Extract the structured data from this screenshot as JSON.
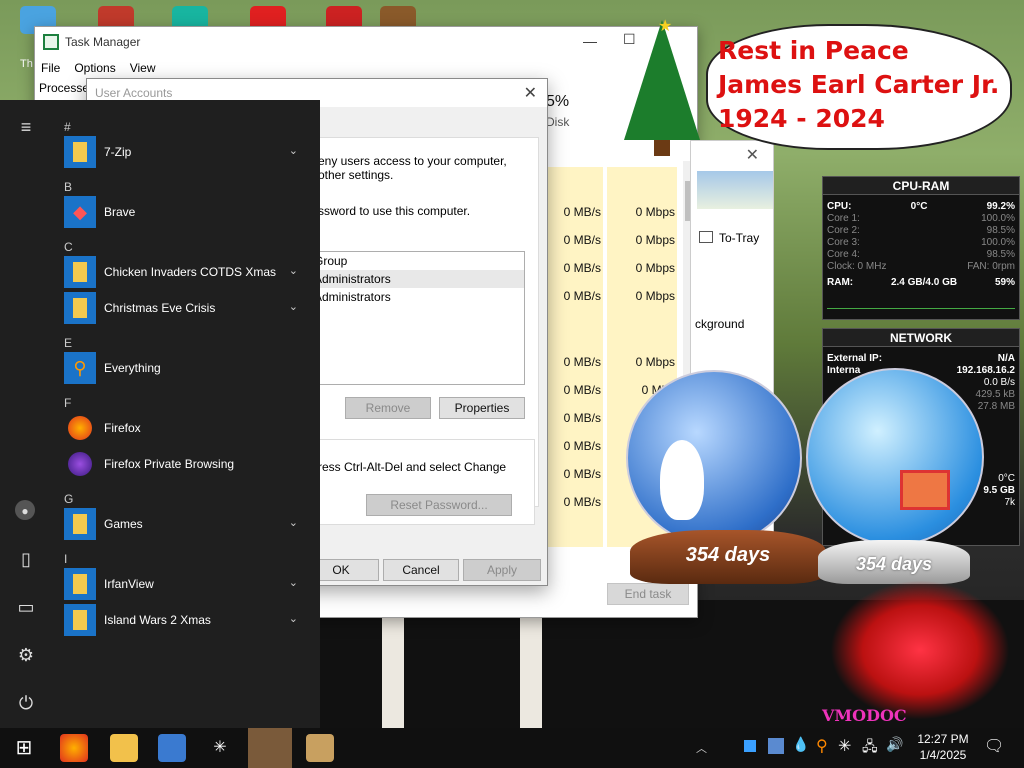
{
  "task_manager": {
    "title": "Task Manager",
    "menu": [
      "File",
      "Options",
      "View"
    ],
    "tab_partial": "Processes",
    "disk_percent": "5%",
    "disk_label": "Disk",
    "disk_rows": [
      "0 MB/s",
      "0 MB/s",
      "0 MB/s",
      "0 MB/s",
      "0 MB/s",
      "0 MB/s",
      "0 MB/s",
      "0 MB/s",
      "0 MB/s",
      "0 MB/s"
    ],
    "network_rows": [
      "0 Mbps",
      "0 Mbps",
      "0 Mbps",
      "0 Mbps",
      "0 Mbps",
      "0 Mbp"
    ],
    "end_task": "End task",
    "side_to_tray": "To-Tray",
    "side_background": "ckground"
  },
  "user_accounts": {
    "title": "User Accounts",
    "desc_line1": "eny users access to your computer,",
    "desc_line2": "other settings.",
    "password_line": "ssword to use this computer.",
    "list_items": [
      "Group",
      "Administrators",
      "Administrators"
    ],
    "remove_button": "Remove",
    "properties_button": "Properties",
    "ctrl_alt_del": "ress Ctrl-Alt-Del and select Change",
    "reset_password_button": "Reset Password...",
    "ok_button": "OK",
    "cancel_button": "Cancel",
    "apply_button": "Apply"
  },
  "start_menu": {
    "sections": [
      {
        "letter": "#",
        "apps": [
          {
            "name": "7-Zip",
            "icon": "folder-icon",
            "expand": true
          }
        ]
      },
      {
        "letter": "B",
        "apps": [
          {
            "name": "Brave",
            "icon": "brave-icon",
            "expand": false
          }
        ]
      },
      {
        "letter": "C",
        "apps": [
          {
            "name": "Chicken Invaders COTDS Xmas",
            "icon": "folder-icon",
            "expand": true
          },
          {
            "name": "Christmas Eve Crisis",
            "icon": "folder-icon",
            "expand": true
          }
        ]
      },
      {
        "letter": "E",
        "apps": [
          {
            "name": "Everything",
            "icon": "search-icon",
            "expand": false
          }
        ]
      },
      {
        "letter": "F",
        "apps": [
          {
            "name": "Firefox",
            "icon": "firefox-icon",
            "expand": false
          },
          {
            "name": "Firefox Private Browsing",
            "icon": "firefox-private-icon",
            "expand": false
          }
        ]
      },
      {
        "letter": "G",
        "apps": [
          {
            "name": "Games",
            "icon": "folder-icon",
            "expand": true
          }
        ]
      },
      {
        "letter": "I",
        "apps": [
          {
            "name": "IrfanView",
            "icon": "folder-icon",
            "expand": true
          },
          {
            "name": "Island Wars 2 Xmas",
            "icon": "folder-icon",
            "expand": true
          }
        ]
      }
    ]
  },
  "rip_note": {
    "line1": "Rest in Peace",
    "line2": "James Earl Carter Jr.",
    "line3": "1924 - 2024"
  },
  "cpu_ram": {
    "title": "CPU-RAM",
    "cpu_label": "CPU:",
    "cpu_temp": "0°C",
    "cpu_pct": "99.2%",
    "cores": [
      {
        "label": "Core 1:",
        "value": "100.0%"
      },
      {
        "label": "Core 2:",
        "value": "98.5%"
      },
      {
        "label": "Core 3:",
        "value": "100.0%"
      },
      {
        "label": "Core 4:",
        "value": "98.5%"
      }
    ],
    "clock_label": "Clock: 0 MHz",
    "fan_label": "FAN: 0rpm",
    "ram_label": "RAM:",
    "ram_used": "2.4 GB/4.0 GB",
    "ram_pct": "59%"
  },
  "network": {
    "title": "NETWORK",
    "external_ip_label": "External IP:",
    "external_ip": "N/A",
    "internal_label": "Interna",
    "internal_ip": "192.168.16.2",
    "rate1": "0.0 B/s",
    "rate2": "429.5 kB",
    "rate3": "27.8 MB",
    "temp": "0°C",
    "size": "9.5 GB",
    "extra": "7k"
  },
  "globes": {
    "left_days": "354 days",
    "right_days": "354 days"
  },
  "taskbar": {
    "time": "12:27 PM",
    "date": "1/4/2025"
  },
  "desktop": {
    "icon_label_partial": "Th"
  }
}
